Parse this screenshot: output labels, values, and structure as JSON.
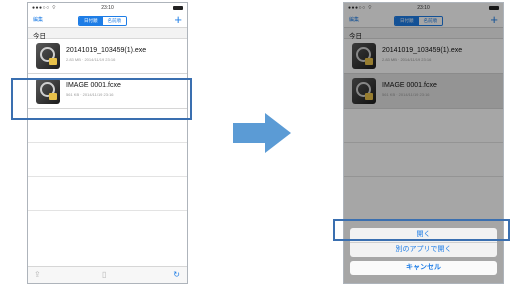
{
  "status": {
    "time": "23:10"
  },
  "nav": {
    "edit": "編集",
    "seg_on": "日付順",
    "seg_off": "名前順",
    "plus": "+"
  },
  "section": "今日",
  "files": [
    {
      "name": "20141019_103459(1).exe",
      "meta": "2.83 MB · 2014/11/19 23:16"
    },
    {
      "name": "IMAGE 0001.fcxe",
      "meta": "561 KB · 2014/11/19 23:16"
    }
  ],
  "sheet": {
    "open": "開く",
    "other_app": "別のアプリで開く",
    "cancel": "キャンセル"
  },
  "colors": {
    "accent": "#1e7de6",
    "highlight": "#3a6fb0",
    "arrow": "#5b9bd5"
  }
}
